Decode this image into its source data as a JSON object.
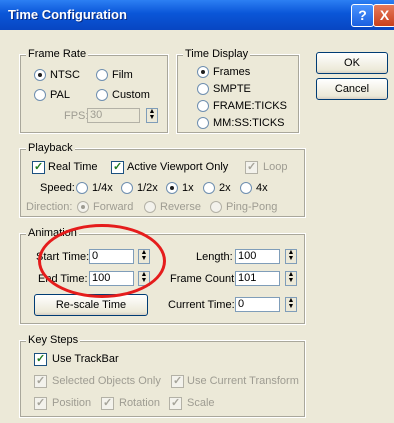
{
  "window": {
    "title": "Time Configuration",
    "help_label": "?",
    "close_label": "X"
  },
  "buttons": {
    "ok": "OK",
    "cancel": "Cancel"
  },
  "frame_rate": {
    "title": "Frame Rate",
    "options": [
      "NTSC",
      "Film",
      "PAL",
      "Custom"
    ],
    "selected": "NTSC",
    "fps_label": "FPS:",
    "fps_value": "30"
  },
  "time_display": {
    "title": "Time Display",
    "options": [
      "Frames",
      "SMPTE",
      "FRAME:TICKS",
      "MM:SS:TICKS"
    ],
    "selected": "Frames"
  },
  "playback": {
    "title": "Playback",
    "real_time": "Real Time",
    "active_viewport_only": "Active Viewport Only",
    "loop": "Loop",
    "speed_label": "Speed:",
    "speeds": [
      "1/4x",
      "1/2x",
      "1x",
      "2x",
      "4x"
    ],
    "speed_selected": "1x",
    "direction_label": "Direction:",
    "directions": [
      "Forward",
      "Reverse",
      "Ping-Pong"
    ],
    "direction_selected": "Forward"
  },
  "animation": {
    "title": "Animation",
    "start_time_label": "Start Time:",
    "start_time": "0",
    "end_time_label": "End Time:",
    "end_time": "100",
    "length_label": "Length:",
    "length": "100",
    "frame_count_label": "Frame Count:",
    "frame_count": "101",
    "current_time_label": "Current Time:",
    "current_time": "0",
    "rescale_label": "Re-scale Time"
  },
  "key_steps": {
    "title": "Key Steps",
    "use_trackbar": "Use TrackBar",
    "selected_objects_only": "Selected Objects Only",
    "use_current_transform": "Use Current Transform",
    "position": "Position",
    "rotation": "Rotation",
    "scale": "Scale"
  },
  "colors": {
    "titlebar": "#0a56d8",
    "highlight_circle": "#e51c1c",
    "dialog_bg": "#ece9d8"
  }
}
